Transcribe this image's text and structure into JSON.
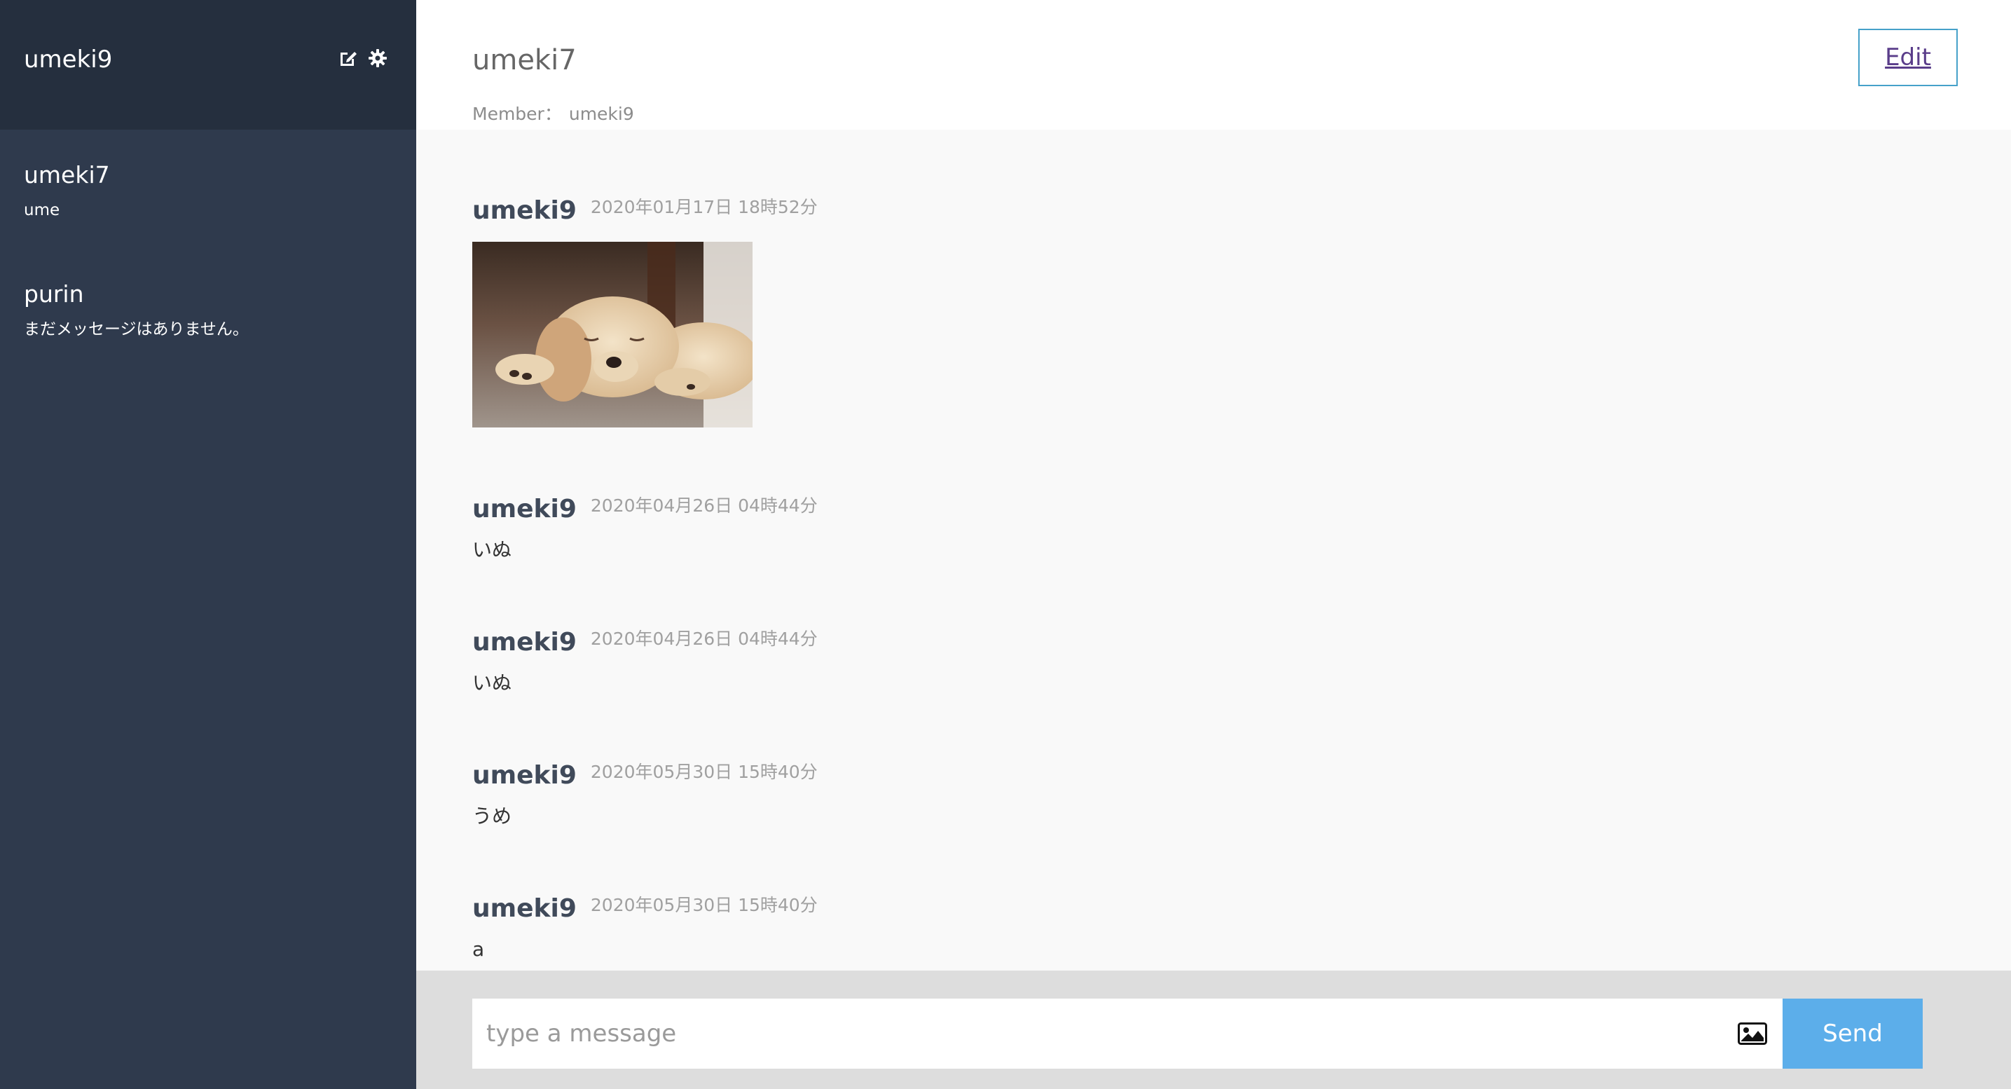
{
  "sidebar": {
    "current_user": "umeki9",
    "icons": [
      "edit-icon",
      "gear-icon"
    ],
    "groups": [
      {
        "name": "umeki7",
        "last_message": "ume"
      },
      {
        "name": "purin",
        "last_message": "まだメッセージはありません。"
      }
    ]
  },
  "header": {
    "title": "umeki7",
    "member_label": "Member：",
    "members": "umeki9",
    "edit_label": "Edit"
  },
  "messages": [
    {
      "user": "umeki9",
      "time": "2020年01月17日 18時52分",
      "text": "",
      "image": "sleeping-puppy-photo"
    },
    {
      "user": "umeki9",
      "time": "2020年04月26日 04時44分",
      "text": "いぬ"
    },
    {
      "user": "umeki9",
      "time": "2020年04月26日 04時44分",
      "text": "いぬ"
    },
    {
      "user": "umeki9",
      "time": "2020年05月30日 15時40分",
      "text": "うめ"
    },
    {
      "user": "umeki9",
      "time": "2020年05月30日 15時40分",
      "text": "a"
    }
  ],
  "form": {
    "placeholder": "type a message",
    "send_label": "Send",
    "image_icon": "image-icon"
  },
  "colors": {
    "sidebar_bg": "#2f3a4d",
    "sidebar_header_bg": "#252f3e",
    "send_button": "#5caeea",
    "edit_border": "#46a1c9"
  }
}
